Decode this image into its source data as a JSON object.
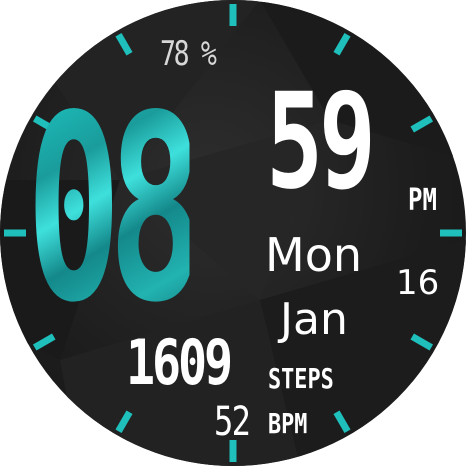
{
  "watch": {
    "time": {
      "hour": "08",
      "minute": "59",
      "ampm": "PM"
    },
    "date": {
      "weekday": "Mon",
      "month": "Jan",
      "day": "16"
    },
    "battery": {
      "text": "78 %"
    },
    "steps": {
      "value": "1609",
      "label": "STEPS"
    },
    "heart_rate": {
      "value": "52",
      "label": "BPM"
    }
  },
  "colors": {
    "accent": "#1fbfbc",
    "background": "#1f1f1f",
    "text": "#ffffff"
  },
  "icons": [
    "hour-tick-marks"
  ]
}
